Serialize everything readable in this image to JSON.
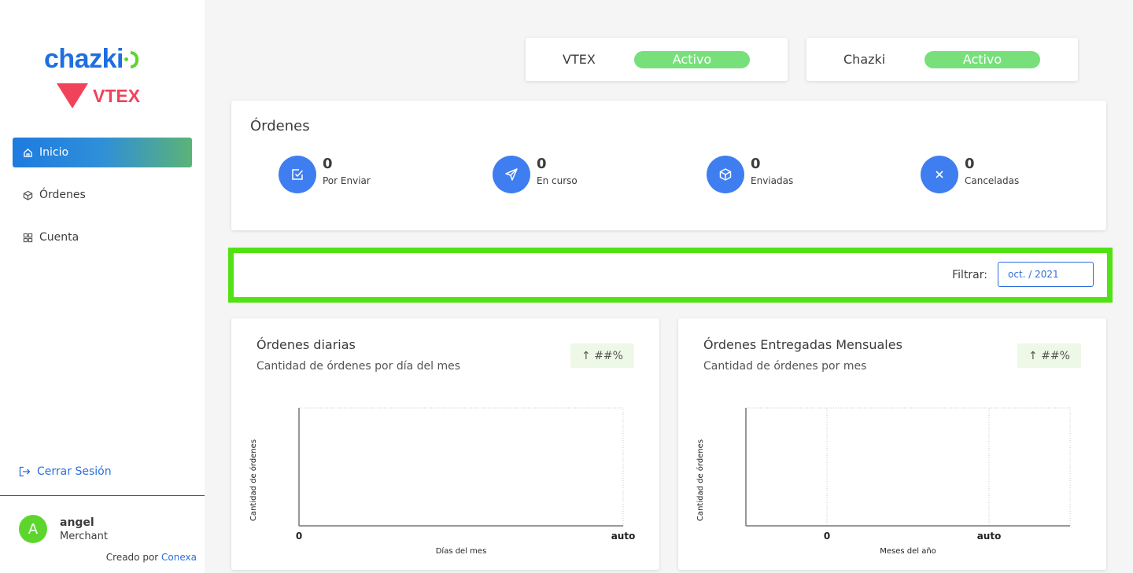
{
  "sidebar": {
    "logo_primary": "chazki",
    "logo_secondary": "VTEX",
    "nav": [
      {
        "label": "Inicio",
        "icon": "home-icon",
        "active": true
      },
      {
        "label": "Órdenes",
        "icon": "box-icon",
        "active": false
      },
      {
        "label": "Cuenta",
        "icon": "grid-icon",
        "active": false
      }
    ],
    "logout_label": "Cerrar Sesión",
    "user": {
      "initial": "A",
      "name": "angel",
      "role": "Merchant"
    },
    "credit_prefix": "Creado por",
    "credit_link": "Conexa"
  },
  "status": [
    {
      "name": "VTEX",
      "state": "Activo"
    },
    {
      "name": "Chazki",
      "state": "Activo"
    }
  ],
  "orders": {
    "title": "Órdenes",
    "stats": [
      {
        "value": "0",
        "label": "Por Enviar",
        "icon": "checkbox-icon"
      },
      {
        "value": "0",
        "label": "En curso",
        "icon": "send-icon"
      },
      {
        "value": "0",
        "label": "Enviadas",
        "icon": "cube-icon"
      },
      {
        "value": "0",
        "label": "Canceladas",
        "icon": "x-icon"
      }
    ]
  },
  "filter": {
    "label": "Filtrar:",
    "value": "oct. / 2021"
  },
  "colors": {
    "accent": "#3f7ef0",
    "active_pill": "#77e07a",
    "highlight": "#52e213"
  },
  "chart_data": [
    {
      "type": "line",
      "title": "Órdenes diarias",
      "subtitle": "Cantidad de órdenes por día del mes",
      "badge": "↑ ##%",
      "xlabel": "Días del mes",
      "ylabel": "Cantidad de órdenes",
      "x_ticks": [
        "0",
        "auto"
      ],
      "series": []
    },
    {
      "type": "line",
      "title": "Órdenes Entregadas Mensuales",
      "subtitle": "Cantidad de órdenes por mes",
      "badge": "↑ ##%",
      "xlabel": "Meses del año",
      "ylabel": "Cantidad de órdenes",
      "x_ticks": [
        "0",
        "auto"
      ],
      "series": []
    }
  ]
}
